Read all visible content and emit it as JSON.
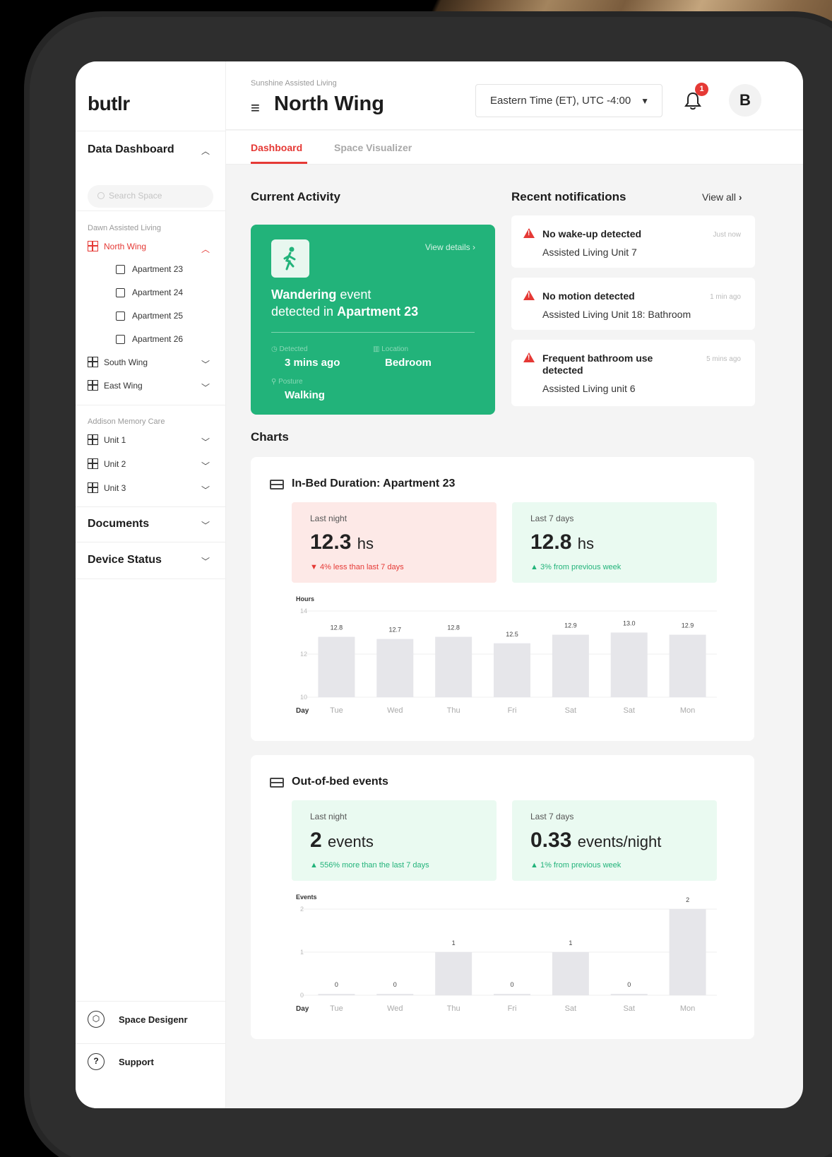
{
  "app": {
    "logo": "butlr"
  },
  "sidebar": {
    "data_dashboard": "Data Dashboard",
    "search_placeholder": "Search Space",
    "group1": "Dawn Assisted Living",
    "north_wing": "North Wing",
    "apartments": [
      "Apartment 23",
      "Apartment 24",
      "Apartment 25",
      "Apartment 26"
    ],
    "south_wing": "South Wing",
    "east_wing": "East Wing",
    "group2": "Addison Memory Care",
    "units": [
      "Unit 1",
      "Unit 2",
      "Unit 3"
    ],
    "documents": "Documents",
    "device_status": "Device Status",
    "space_designer": "Space Desigenr",
    "support": "Support"
  },
  "header": {
    "org": "Sunshine Assisted Living",
    "title": "North Wing",
    "timezone": "Eastern Time (ET), UTC -4:00",
    "notif_count": "1",
    "avatar": "B"
  },
  "tabs": [
    "Dashboard",
    "Space Visualizer"
  ],
  "current_activity": {
    "heading": "Current Activity",
    "view_details": "View details",
    "event_bold": "Wandering",
    "event_text": " event",
    "detected_text": "detected in ",
    "location_bold": "Apartment 23",
    "detected_label": "Detected",
    "detected_value": "3 mins ago",
    "location_label": "Location",
    "location_value": "Bedroom",
    "posture_label": "Posture",
    "posture_value": "Walking"
  },
  "notifications": {
    "heading": "Recent notifications",
    "view_all": "View all",
    "items": [
      {
        "title": "No wake-up detected",
        "subtitle": "Assisted Living Unit 7",
        "time": "Just now"
      },
      {
        "title": "No motion detected",
        "subtitle": "Assisted Living Unit 18: Bathroom",
        "time": "1 min ago"
      },
      {
        "title": "Frequent bathroom use",
        "title2": "detected",
        "subtitle": "Assisted Living unit 6",
        "time": "5 mins ago"
      }
    ]
  },
  "charts_heading": "Charts",
  "inbed": {
    "title": "In-Bed Duration: Apartment 23",
    "last_night_label": "Last night",
    "last_night_value": "12.3",
    "unit": "hs",
    "last_night_trend": "4% less than last 7 days",
    "last7_label": "Last 7 days",
    "last7_value": "12.8",
    "last7_trend": "3% from previous week"
  },
  "outbed": {
    "title": "Out-of-bed events",
    "last_night_label": "Last night",
    "last_night_value": "2",
    "last_night_unit": "events",
    "last_night_trend": "556% more than the last 7 days",
    "last7_label": "Last 7 days",
    "last7_value": "0.33",
    "last7_unit": "events/night",
    "last7_trend": "1% from previous week"
  },
  "chart_data": [
    {
      "type": "bar",
      "ylabel": "Hours",
      "xlabel": "Day",
      "categories": [
        "Tue",
        "Wed",
        "Thu",
        "Fri",
        "Sat",
        "Sat",
        "Mon"
      ],
      "values": [
        12.8,
        12.7,
        12.8,
        12.5,
        12.9,
        13.0,
        12.9
      ],
      "value_labels": [
        "12.8",
        "12.7",
        "12.8",
        "12.5",
        "12.9",
        "13.0",
        "12.9"
      ],
      "ylim": [
        10,
        14
      ],
      "yticks": [
        "14",
        "12",
        "10"
      ]
    },
    {
      "type": "bar",
      "ylabel": "Events",
      "xlabel": "Day",
      "categories": [
        "Tue",
        "Wed",
        "Thu",
        "Fri",
        "Sat",
        "Sat",
        "Mon"
      ],
      "values": [
        0,
        0,
        1,
        0,
        1,
        0,
        2
      ],
      "value_labels": [
        "0",
        "0",
        "1",
        "0",
        "1",
        "0",
        "2"
      ],
      "ylim": [
        0,
        2
      ],
      "yticks": [
        "2",
        "1",
        "0"
      ]
    }
  ],
  "colors": {
    "accent": "#e53935",
    "green": "#22b37a",
    "bar": "#e6e6ea"
  }
}
